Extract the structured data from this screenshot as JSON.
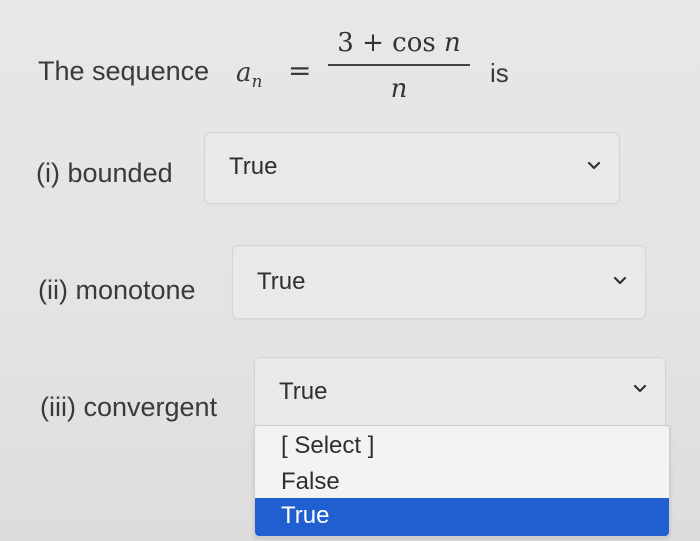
{
  "question": {
    "prefix": "The sequence",
    "var": "a",
    "var_sub": "n",
    "equals": "=",
    "numerator_plain": "3 + cos ",
    "numerator_var": "n",
    "denominator": "n",
    "suffix": "is"
  },
  "items": [
    {
      "label": "(i) bounded",
      "value": "True"
    },
    {
      "label": "(ii) monotone",
      "value": "True"
    },
    {
      "label": "(iii) convergent",
      "value": "True"
    }
  ],
  "dropdown": {
    "options": [
      "[ Select ]",
      "False",
      "True"
    ],
    "selected": "True"
  },
  "colors": {
    "highlight": "#1f5fd0",
    "background": "#e7e5e4"
  },
  "icons": {
    "chevron": "chevron-down-icon"
  }
}
